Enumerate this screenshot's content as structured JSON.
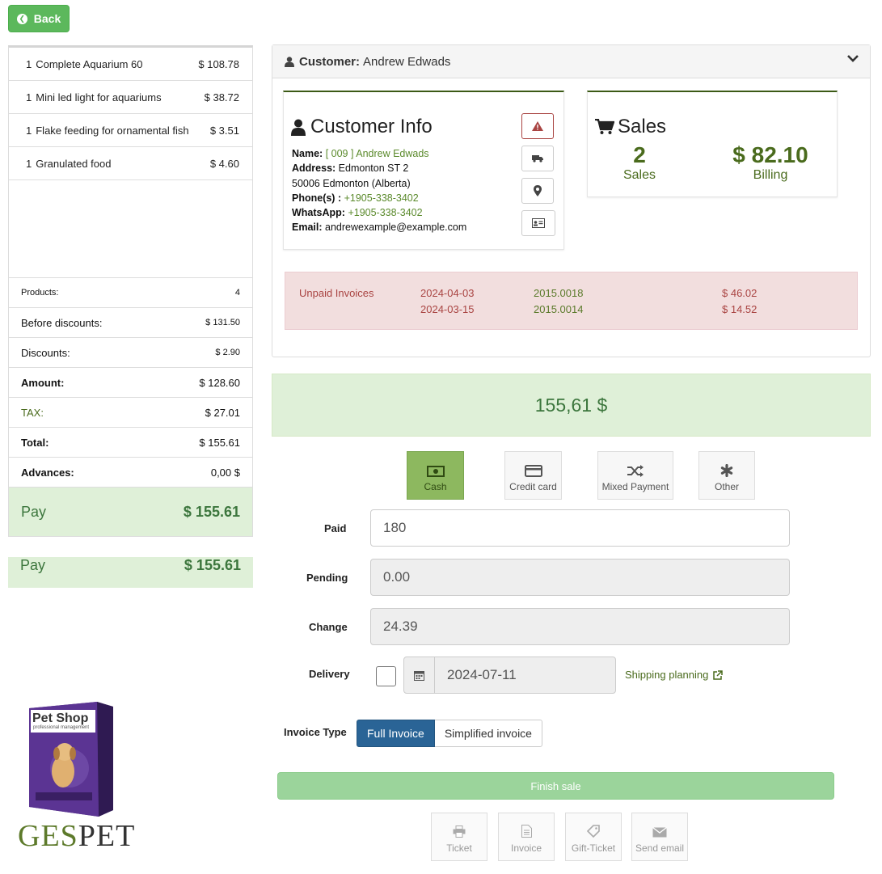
{
  "back_label": "Back",
  "items": [
    {
      "qty": "1",
      "name": "Complete Aquarium 60",
      "price": "$ 108.78"
    },
    {
      "qty": "1",
      "name": "Mini led light for aquariums",
      "price": "$ 38.72"
    },
    {
      "qty": "1",
      "name": "Flake feeding for ornamental fish",
      "price": "$ 3.51"
    },
    {
      "qty": "1",
      "name": "Granulated food",
      "price": "$ 4.60"
    }
  ],
  "totals": {
    "products_label": "Products:",
    "products_value": "4",
    "before_label": "Before discounts:",
    "before_value": "$ 131.50",
    "discounts_label": "Discounts:",
    "discounts_value": "$ 2.90",
    "amount_label": "Amount:",
    "amount_value": "$ 128.60",
    "tax_label": "TAX:",
    "tax_value": "$ 27.01",
    "total_label": "Total:",
    "total_value": "$ 155.61",
    "advances_label": "Advances:",
    "advances_value": "0,00 $",
    "pay_label": "Pay",
    "pay_value": "$ 155.61"
  },
  "logo": {
    "box_title": "Pet Shop",
    "box_subtitle": "professional management",
    "wordmark_a": "GES",
    "wordmark_b": "PET"
  },
  "customer": {
    "header_label": "Customer:",
    "header_name": "Andrew Edwads",
    "info_title": "Customer Info",
    "name_label": "Name:",
    "name_value": "[ 009 ] Andrew Edwads",
    "address_label": "Address:",
    "address_value": "Edmonton ST 2",
    "address_line2": "50006  Edmonton (Alberta)",
    "phone_label": "Phone(s) :",
    "phone_value": "+1905-338-3402",
    "whatsapp_label": "WhatsApp:",
    "whatsapp_value": "+1905-338-3402",
    "email_label": "Email:",
    "email_value": "andrewexample@example.com"
  },
  "sales": {
    "title": "Sales",
    "count": "2",
    "count_label": "Sales",
    "billing": "$ 82.10",
    "billing_label": "Billing"
  },
  "unpaid": {
    "label": "Unpaid Invoices",
    "rows": [
      {
        "date": "2024-04-03",
        "number": "2015.0018",
        "amount": "$ 46.02"
      },
      {
        "date": "2024-03-15",
        "number": "2015.0014",
        "amount": "$ 14.52"
      }
    ]
  },
  "total_display": "155,61 $",
  "payment_methods": [
    {
      "label": "Cash",
      "icon": "cash-icon",
      "active": true
    },
    {
      "label": "Credit card",
      "icon": "credit-card-icon",
      "active": false
    },
    {
      "label": "Mixed Payment",
      "icon": "shuffle-icon",
      "active": false
    },
    {
      "label": "Other",
      "icon": "asterisk-icon",
      "active": false
    }
  ],
  "form": {
    "paid_label": "Paid",
    "paid_value": "180",
    "pending_label": "Pending",
    "pending_value": "0.00",
    "change_label": "Change",
    "change_value": "24.39",
    "delivery_label": "Delivery",
    "delivery_date": "2024-07-11",
    "shipping_link": "Shipping planning",
    "invoice_type_label": "Invoice Type",
    "full_invoice": "Full Invoice",
    "simplified_invoice": "Simplified invoice"
  },
  "finish_label": "Finish sale",
  "actions": [
    {
      "label": "Ticket",
      "icon": "printer-icon"
    },
    {
      "label": "Invoice",
      "icon": "document-icon"
    },
    {
      "label": "Gift-Ticket",
      "icon": "tag-icon"
    },
    {
      "label": "Send email",
      "icon": "envelope-icon"
    }
  ],
  "colors": {
    "accent_green": "#5cb85c",
    "olive": "#4a6b1d",
    "primary_blue": "#2a6496",
    "danger": "#a94442"
  }
}
